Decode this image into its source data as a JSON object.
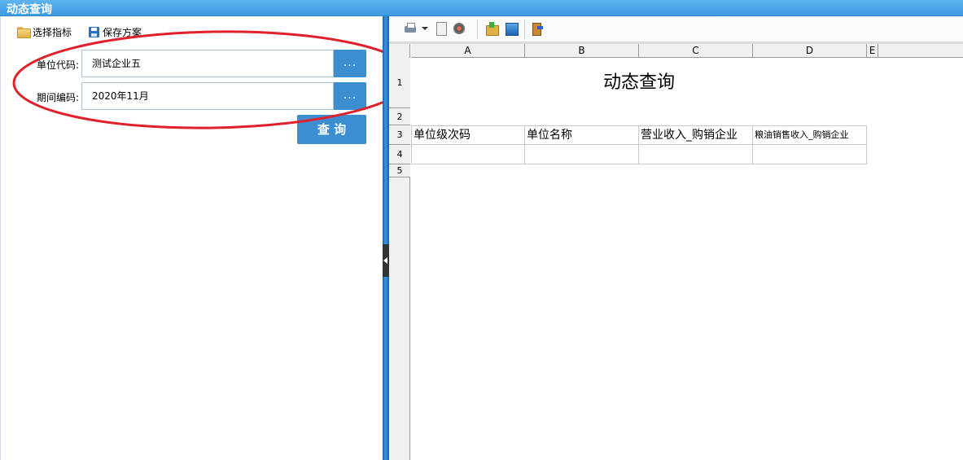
{
  "window": {
    "title": "动态查询"
  },
  "left_toolbar": {
    "select_indicator_label": "选择指标",
    "save_scheme_label": "保存方案"
  },
  "form": {
    "unit_code": {
      "label": "单位代码:",
      "value": "测试企业五",
      "button": "..."
    },
    "period_code": {
      "label": "期间编码:",
      "value": "2020年11月",
      "button": "..."
    },
    "query_button": "查 询"
  },
  "sheet": {
    "columns": [
      "A",
      "B",
      "C",
      "D",
      "E"
    ],
    "rows": [
      "1",
      "2",
      "3",
      "4",
      "5"
    ],
    "title": "动态查询",
    "headers": [
      "单位级次码",
      "单位名称",
      "营业收入_购销企业",
      "粮油销售收入_购销企业"
    ]
  },
  "colors": {
    "accent": "#3b8fd0",
    "titlebar": "#4aa6e8",
    "annotation_ellipse": "#e0212b"
  },
  "icons": [
    "folder-icon",
    "save-icon",
    "printer-icon",
    "page-icon",
    "disc-icon",
    "export-icon",
    "image-icon",
    "exit-icon"
  ]
}
